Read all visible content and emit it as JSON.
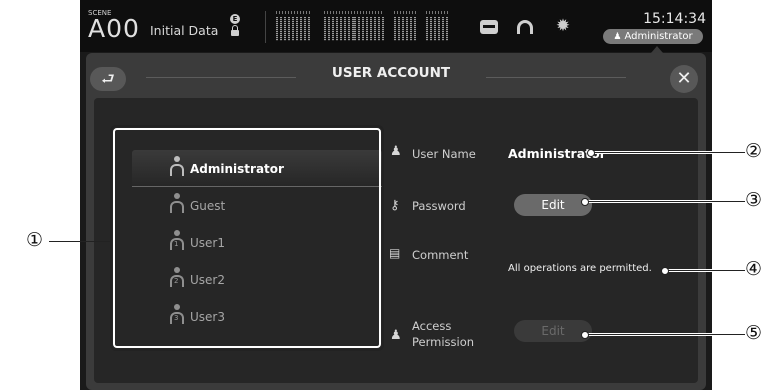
{
  "scene": {
    "caption": "SCENE",
    "number": "A00",
    "title": "Initial Data"
  },
  "status": {
    "clock": "15:14:34",
    "current_user": "Administrator"
  },
  "dialog": {
    "title": "USER ACCOUNT"
  },
  "users": [
    {
      "label": "Administrator",
      "selected": true
    },
    {
      "label": "Guest"
    },
    {
      "label": "User1",
      "index": "1"
    },
    {
      "label": "User2",
      "index": "2"
    },
    {
      "label": "User3",
      "index": "3"
    }
  ],
  "details": {
    "user_name_label": "User Name",
    "user_name_value": "Administrator",
    "password_label": "Password",
    "password_edit": "Edit",
    "comment_label": "Comment",
    "comment_value": "All operations are permitted.",
    "access_label_1": "Access",
    "access_label_2": "Permission",
    "access_edit": "Edit"
  },
  "callouts": [
    "①",
    "②",
    "③",
    "④",
    "⑤"
  ]
}
